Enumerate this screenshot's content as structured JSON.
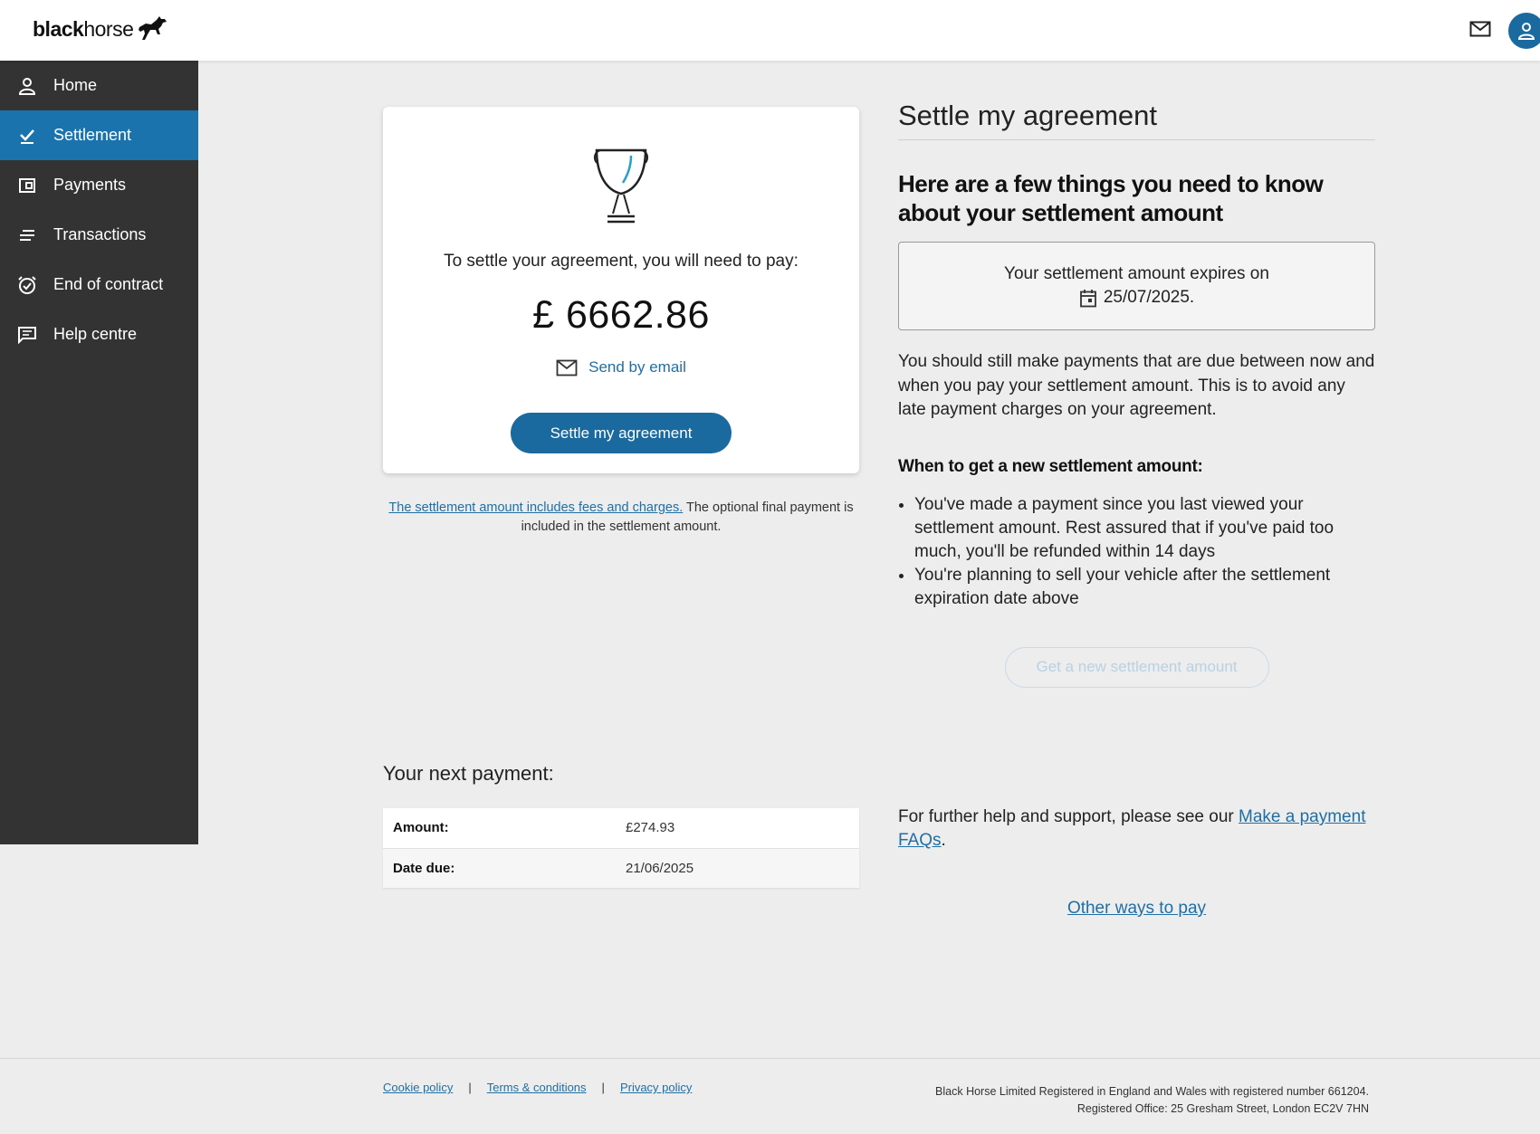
{
  "brand": {
    "logo_bold": "black",
    "logo_light": "horse",
    "accent_color": "#1a6aa0",
    "sidebar_color": "#333333"
  },
  "header": {
    "mail_icon": "mail-icon",
    "profile_icon": "user-icon"
  },
  "sidebar": {
    "items": [
      {
        "label": "Home",
        "icon": "person-icon",
        "active": false
      },
      {
        "label": "Settlement",
        "icon": "checkmark-icon",
        "active": true
      },
      {
        "label": "Payments",
        "icon": "wallet-icon",
        "active": false
      },
      {
        "label": "Transactions",
        "icon": "lines-icon",
        "active": false
      },
      {
        "label": "End of contract",
        "icon": "alarm-clock-icon",
        "active": false
      },
      {
        "label": "Help centre",
        "icon": "chat-icon",
        "active": false
      }
    ]
  },
  "settlement_card": {
    "lead": "To settle your agreement, you will need to pay:",
    "amount": "£ 6662.86",
    "send_email": "Send by email",
    "settle_button": "Settle my agreement"
  },
  "fees_note": {
    "link": "The settlement amount includes fees and charges.",
    "text": " The optional final payment is included in the settlement amount."
  },
  "info": {
    "title": "Settle my agreement",
    "subheading": "Here are a few things you need to know about your settlement amount",
    "expiry_label": "Your settlement amount expires on",
    "expiry_date": "25/07/2025.",
    "paragraph": "You should still make payments that are due between now and when you pay your settlement amount. This is to avoid any late payment charges on your agreement.",
    "when_heading": "When to get a new settlement amount:",
    "bullets": [
      "You've made a payment since you last viewed your settlement amount. Rest assured that if you've paid too much, you'll be refunded within 14 days",
      "You're planning to sell your vehicle after the settlement expiration date above"
    ],
    "new_amount_button": "Get a new settlement amount"
  },
  "next_payment": {
    "title": "Your next payment:",
    "rows": [
      {
        "label": "Amount:",
        "value": "£274.93"
      },
      {
        "label": "Date due:",
        "value": "21/06/2025"
      }
    ]
  },
  "help": {
    "text": "For further help and support, please see our ",
    "link": "Make a payment FAQs",
    "trail": ".",
    "other_ways": "Other ways to pay"
  },
  "footer": {
    "links": [
      "Cookie policy",
      "Terms & conditions",
      "Privacy policy"
    ],
    "separator": "|",
    "legal_line1": "Black Horse Limited Registered in England and Wales with registered number 661204.",
    "legal_line2": "Registered Office: 25 Gresham Street, London EC2V 7HN"
  }
}
